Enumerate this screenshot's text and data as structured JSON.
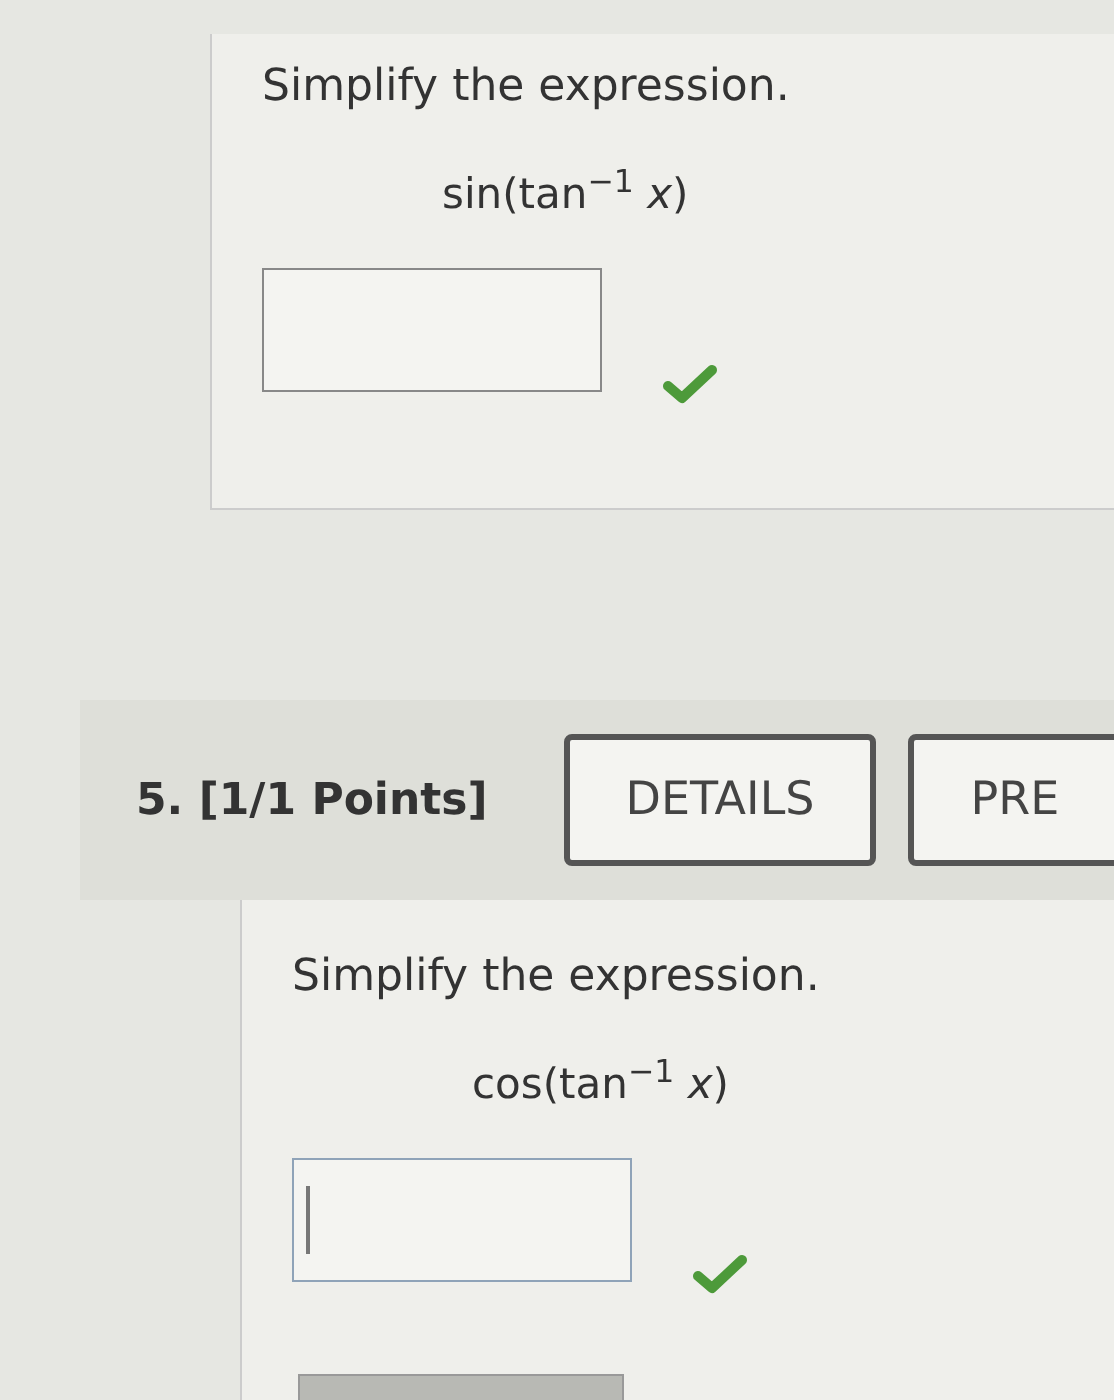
{
  "questions": [
    {
      "prompt": "Simplify the expression.",
      "expression": "sin(tan$^{−1}$ *x*)",
      "answer": {
        "focused": false,
        "correct": true
      }
    },
    {
      "number": "5. [1/1 Points]",
      "buttons": [
        "DETAILS",
        "PRE"
      ],
      "prompt": "Simplify the expression.",
      "expression": "cos(tan$^{−1}$ *x*)",
      "answer": {
        "focused": true,
        "correct": true
      }
    }
  ]
}
